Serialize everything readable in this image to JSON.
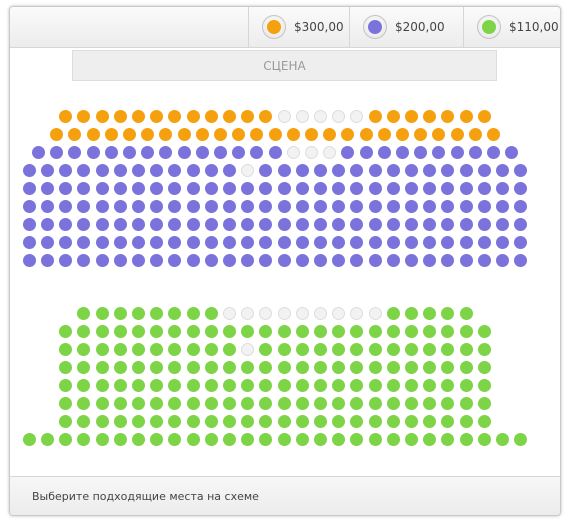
{
  "colors": {
    "premium": "#f5a00e",
    "standard": "#7b72dc",
    "economy": "#7dd447",
    "taken": "#f2f2f2"
  },
  "legend": [
    {
      "tier": "premium",
      "price": "$300,00",
      "icon": "orange-dot-icon"
    },
    {
      "tier": "standard",
      "price": "$200,00",
      "icon": "purple-dot-icon"
    },
    {
      "tier": "economy",
      "price": "$110,00",
      "icon": "green-dot-icon"
    }
  ],
  "stage_label": "СЦЕНА",
  "footer_text": "Выберите подходящие места на схеме",
  "rows": [
    {
      "tier": "premium",
      "seats": 24,
      "taken": [
        12,
        13,
        14,
        15,
        16
      ]
    },
    {
      "tier": "premium",
      "seats": 25,
      "taken": []
    },
    {
      "tier": "standard",
      "seats": 27,
      "taken": [
        14,
        15,
        16
      ]
    },
    {
      "tier": "standard",
      "seats": 28,
      "taken": [
        12
      ]
    },
    {
      "tier": "standard",
      "seats": 28,
      "taken": []
    },
    {
      "tier": "standard",
      "seats": 28,
      "taken": []
    },
    {
      "tier": "standard",
      "seats": 28,
      "taken": []
    },
    {
      "tier": "standard",
      "seats": 28,
      "taken": []
    },
    {
      "tier": "standard",
      "seats": 28,
      "taken": []
    },
    {
      "tier": "economy",
      "seats": 22,
      "taken": [
        8,
        9,
        10,
        11,
        12,
        13,
        14,
        15,
        16
      ]
    },
    {
      "tier": "economy",
      "seats": 24,
      "taken": []
    },
    {
      "tier": "economy",
      "seats": 24,
      "taken": [
        10
      ]
    },
    {
      "tier": "economy",
      "seats": 24,
      "taken": []
    },
    {
      "tier": "economy",
      "seats": 24,
      "taken": []
    },
    {
      "tier": "economy",
      "seats": 24,
      "taken": []
    },
    {
      "tier": "economy",
      "seats": 24,
      "taken": []
    },
    {
      "tier": "economy",
      "seats": 28,
      "taken": []
    }
  ]
}
